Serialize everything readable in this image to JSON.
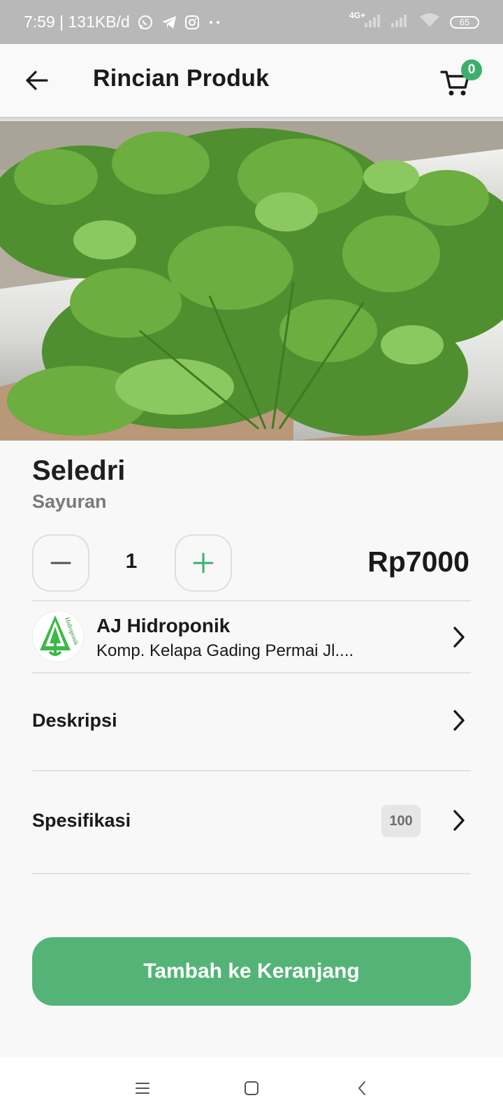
{
  "status_bar": {
    "time_speed": "7:59 | 131KB/d",
    "network": "4G+",
    "battery": "65",
    "icons": [
      "whatsapp-icon",
      "telegram-icon",
      "instagram-icon",
      "more-dots-icon",
      "signal-icon",
      "wifi-icon",
      "battery-icon"
    ]
  },
  "app_bar": {
    "title": "Rincian Produk",
    "cart_count": "0",
    "icons": [
      "arrow-left-icon",
      "cart-icon"
    ]
  },
  "product": {
    "name": "Seledri",
    "category": "Sayuran",
    "quantity": "1",
    "price": "Rp7000",
    "image": "celery-photo"
  },
  "store": {
    "name": "AJ Hidroponik",
    "address": "Komp. Kelapa Gading Permai Jl....",
    "logo_text": "Hidroponik"
  },
  "sections": {
    "description_label": "Deskripsi",
    "specification_label": "Spesifikasi",
    "stock": "100"
  },
  "cta": {
    "label": "Tambah ke Keranjang"
  },
  "colors": {
    "accent": "#54b478",
    "badge": "#3dae6c",
    "status_bar": "#b8b8b8"
  }
}
